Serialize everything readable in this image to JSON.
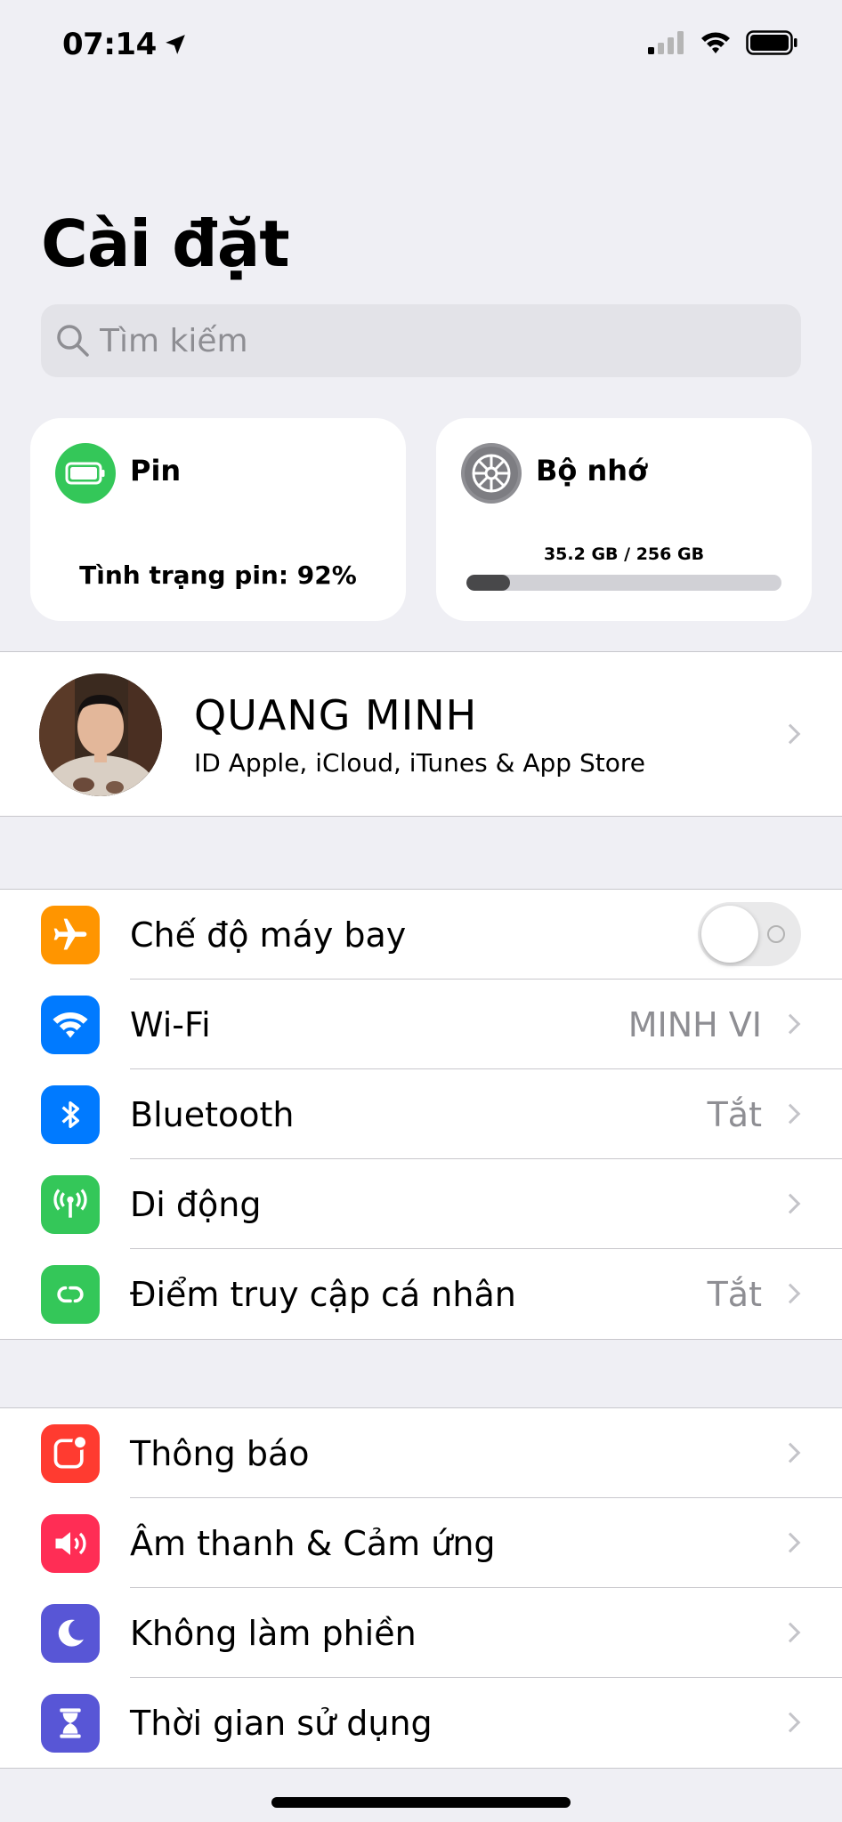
{
  "status_bar": {
    "time": "07:14",
    "icons": [
      "location-arrow-icon",
      "cellular-signal-icon",
      "wifi-icon",
      "battery-icon"
    ]
  },
  "page": {
    "title": "Cài đặt",
    "search_placeholder": "Tìm kiếm"
  },
  "battery_card": {
    "title": "Pin",
    "status": "Tình trạng pin: 92%",
    "icon": "battery-icon",
    "icon_color": "#34c759"
  },
  "storage_card": {
    "title": "Bộ nhớ",
    "usage_text": "35.2 GB / 256 GB",
    "used_fraction": 0.1375,
    "icon": "gear-icon",
    "icon_color": "#8e8e93"
  },
  "profile": {
    "name": "QUANG MINH",
    "subtitle": "ID Apple, iCloud, iTunes & App Store"
  },
  "network_group": [
    {
      "label": "Chế độ máy bay",
      "icon": "airplane-icon",
      "color": "#ff9500",
      "toggle": false
    },
    {
      "label": "Wi-Fi",
      "value": "MINH VI",
      "icon": "wifi-icon",
      "color": "#007aff"
    },
    {
      "label": "Bluetooth",
      "value": "Tắt",
      "icon": "bluetooth-icon",
      "color": "#007aff"
    },
    {
      "label": "Di động",
      "icon": "antenna-icon",
      "color": "#34c759"
    },
    {
      "label": "Điểm truy cập cá nhân",
      "value": "Tắt",
      "icon": "hotspot-icon",
      "color": "#34c759"
    }
  ],
  "notify_group": [
    {
      "label": "Thông báo",
      "icon": "notifications-icon",
      "color": "#ff3b30"
    },
    {
      "label": "Âm thanh & Cảm ứng",
      "icon": "speaker-icon",
      "color": "#ff2d55"
    },
    {
      "label": "Không làm phiền",
      "icon": "moon-icon",
      "color": "#5856d6"
    },
    {
      "label": "Thời gian sử dụng",
      "icon": "hourglass-icon",
      "color": "#5856d6"
    }
  ]
}
